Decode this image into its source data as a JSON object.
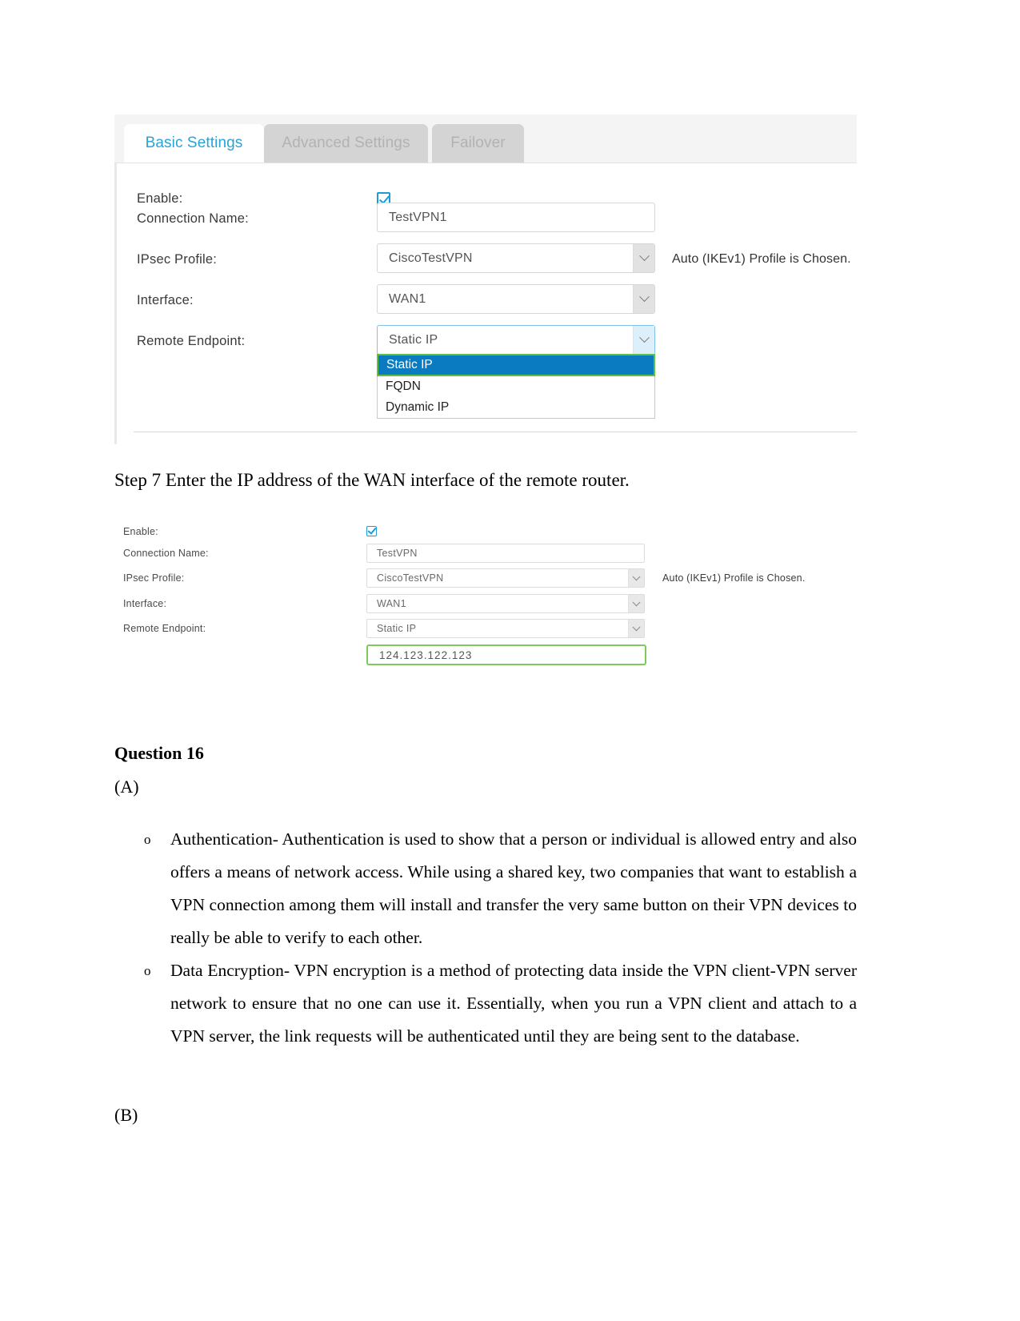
{
  "screenshot1": {
    "tabs": [
      {
        "label": "Basic Settings",
        "active": true
      },
      {
        "label": "Advanced Settings",
        "active": false
      },
      {
        "label": "Failover",
        "active": false
      }
    ],
    "fields": {
      "enable_label": "Enable:",
      "connection_name_label": "Connection Name:",
      "connection_name_value": "TestVPN1",
      "ipsec_profile_label": "IPsec Profile:",
      "ipsec_profile_value": "CiscoTestVPN",
      "ipsec_profile_note": "Auto (IKEv1) Profile is Chosen.",
      "interface_label": "Interface:",
      "interface_value": "WAN1",
      "remote_endpoint_label": "Remote Endpoint:",
      "remote_endpoint_value": "Static IP"
    },
    "remote_endpoint_options": [
      {
        "label": "Static IP",
        "selected": true
      },
      {
        "label": "FQDN",
        "selected": false
      },
      {
        "label": "Dynamic IP",
        "selected": false
      }
    ],
    "colors": {
      "active_tab_text": "#2aa3d4",
      "inactive_tab_bg": "#d4d4d4",
      "inactive_tab_text": "#b2b2b2",
      "option_highlight_bg": "#0b7bc1",
      "option_highlight_border": "#62c041",
      "checkbox_accent": "#1f9ad6"
    }
  },
  "step_text": "Step 7 Enter the IP address of the WAN interface of the remote router.",
  "screenshot2": {
    "fields": {
      "enable_label": "Enable:",
      "connection_name_label": "Connection Name:",
      "connection_name_value": "TestVPN",
      "ipsec_profile_label": "IPsec Profile:",
      "ipsec_profile_value": "CiscoTestVPN",
      "ipsec_profile_note": "Auto (IKEv1) Profile is Chosen.",
      "interface_label": "Interface:",
      "interface_value": "WAN1",
      "remote_endpoint_label": "Remote Endpoint:",
      "remote_endpoint_value": "Static IP",
      "remote_ip_value": "124.123.122.123"
    },
    "colors": {
      "ip_field_border": "#7ec95a",
      "checkbox_accent": "#1f9ad6"
    }
  },
  "document": {
    "question_heading": "Question 16",
    "part_a_label": "(A)",
    "part_b_label": "(B)",
    "bullet_marker": "o",
    "bullets": [
      "Authentication- Authentication is used to show that a person or individual is allowed entry and also offers a means of network access. While using a shared key, two companies that want to establish a VPN connection among them will install and transfer the very same button on their VPN devices to really be able to verify to each other.",
      "Data Encryption- VPN encryption is a method of protecting data inside the VPN client-VPN server network to ensure that no one can use it. Essentially, when you run a VPN client and attach to a VPN server, the link requests will be authenticated until they are being sent to the database."
    ]
  }
}
